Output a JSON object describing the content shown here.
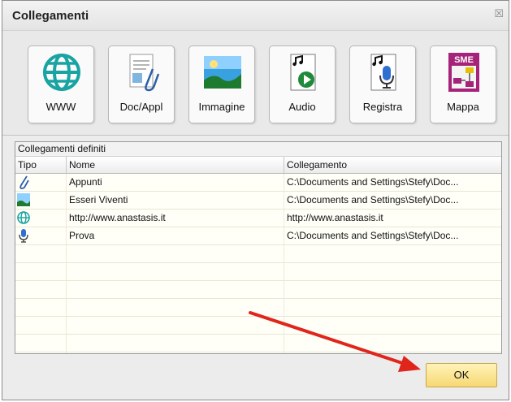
{
  "window": {
    "title": "Collegamenti",
    "close_glyph": "☒"
  },
  "toolbar": {
    "buttons": [
      {
        "label": "WWW",
        "icon": "globe-icon"
      },
      {
        "label": "Doc/Appl",
        "icon": "document-clip-icon"
      },
      {
        "label": "Immagine",
        "icon": "landscape-image-icon"
      },
      {
        "label": "Audio",
        "icon": "audio-play-icon"
      },
      {
        "label": "Registra",
        "icon": "microphone-icon"
      },
      {
        "label": "Mappa",
        "icon": "sme-map-icon",
        "badge": "SME"
      }
    ]
  },
  "list": {
    "caption": "Collegamenti definiti",
    "columns": [
      "Tipo",
      "Nome",
      "Collegamento"
    ],
    "rows": [
      {
        "tipo_icon": "paperclip-icon",
        "nome": "Appunti",
        "collegamento": "C:\\Documents and Settings\\Stefy\\Doc..."
      },
      {
        "tipo_icon": "image-icon",
        "nome": "Esseri Viventi",
        "collegamento": "C:\\Documents and Settings\\Stefy\\Doc..."
      },
      {
        "tipo_icon": "globe-icon",
        "nome": "http://www.anastasis.it",
        "collegamento": "http://www.anastasis.it"
      },
      {
        "tipo_icon": "microphone-icon",
        "nome": "Prova",
        "collegamento": "C:\\Documents and Settings\\Stefy\\Doc..."
      }
    ],
    "empty_rows": 7
  },
  "footer": {
    "ok_label": "OK"
  },
  "colors": {
    "arrow": "#e0251b",
    "ok_button": "#f7d873",
    "globe": "#1aa3a3"
  }
}
